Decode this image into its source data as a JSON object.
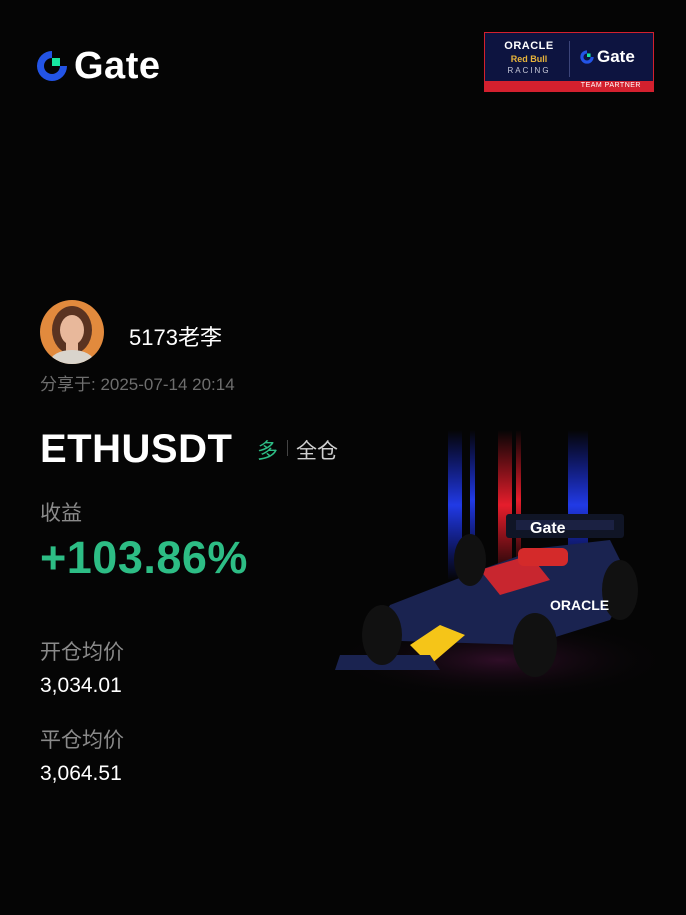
{
  "brand": {
    "name": "Gate",
    "accent": "#2354e6",
    "accent2": "#17e6a1"
  },
  "partner_badge": {
    "oracle": "ORACLE",
    "red_bull": "Red Bull",
    "racing": "RACING",
    "gate": "Gate",
    "tagline": "TEAM PARTNER"
  },
  "user": {
    "name": "5173老李",
    "avatar_icon": "user-avatar"
  },
  "share": {
    "text": "分享于: 2025-07-14 20:14"
  },
  "position": {
    "pair": "ETHUSDT",
    "side": "多",
    "margin_mode": "全仓",
    "pnl_label": "收益",
    "pnl_value": "+103.86%",
    "entry_label": "开仓均价",
    "entry_price": "3,034.01",
    "exit_label": "平仓均价",
    "exit_price": "3,064.51"
  },
  "colors": {
    "profit": "#2dbd85",
    "background": "#050505"
  },
  "illustration": {
    "icon": "f1-race-car"
  }
}
